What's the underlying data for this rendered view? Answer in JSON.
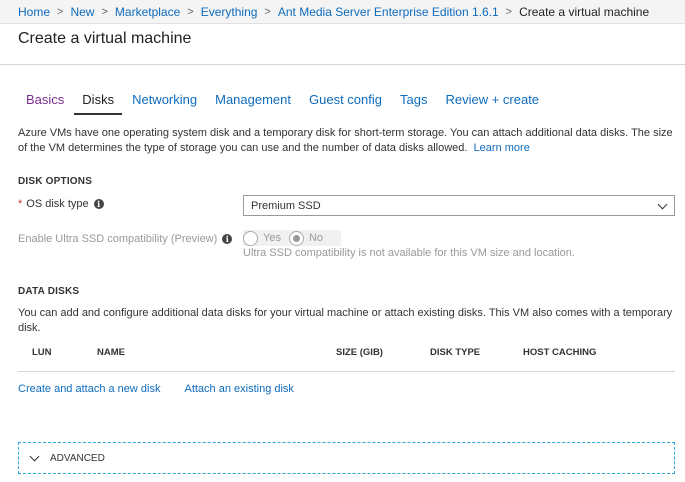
{
  "breadcrumb": {
    "items": [
      "Home",
      "New",
      "Marketplace",
      "Everything",
      "Ant Media Server Enterprise Edition 1.6.1"
    ],
    "current": "Create a virtual machine"
  },
  "page": {
    "title": "Create a virtual machine"
  },
  "tabs": [
    "Basics",
    "Disks",
    "Networking",
    "Management",
    "Guest config",
    "Tags",
    "Review + create"
  ],
  "intro": {
    "text": "Azure VMs have one operating system disk and a temporary disk for short-term storage. You can attach additional data disks. The size of the VM determines the type of storage you can use and the number of data disks allowed.",
    "learn_more": "Learn more"
  },
  "disk_options": {
    "heading": "DISK OPTIONS",
    "os_disk_label": "OS disk type",
    "required_mark": "*",
    "os_disk_value": "Premium SSD",
    "ultra_label": "Enable Ultra SSD compatibility (Preview)",
    "ultra_yes": "Yes",
    "ultra_no": "No",
    "ultra_selected": "No",
    "ultra_note": "Ultra SSD compatibility is not available for this VM size and location."
  },
  "data_disks": {
    "heading": "DATA DISKS",
    "text": "You can add and configure additional data disks for your virtual machine or attach existing disks. This VM also comes with a temporary disk.",
    "columns": [
      "LUN",
      "NAME",
      "SIZE (GIB)",
      "DISK TYPE",
      "HOST CACHING"
    ],
    "create_link": "Create and attach a new disk",
    "attach_link": "Attach an existing disk"
  },
  "advanced": {
    "label": "ADVANCED"
  },
  "colors": {
    "link": "#0f6cbd",
    "required": "#d13438",
    "visited_tab": "#7a2e8f",
    "advanced_border": "#2aa7d8"
  }
}
